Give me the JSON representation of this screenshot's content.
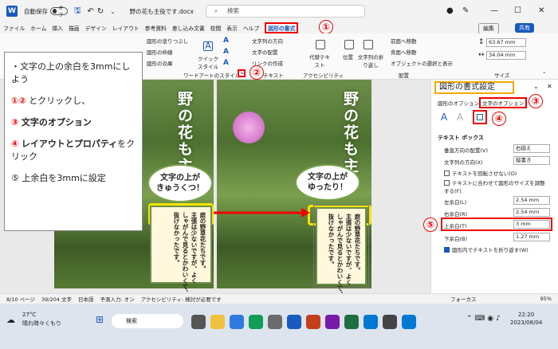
{
  "titlebar": {
    "autosave": "自動保存",
    "autosave_state": "オフ",
    "doc_title": "野の花も主役です.docx",
    "search": "検索"
  },
  "menu": [
    "ファイル",
    "ホーム",
    "挿入",
    "描画",
    "デザイン",
    "レイアウト",
    "参考資料",
    "差し込み文書",
    "校閲",
    "表示",
    "ヘルプ",
    "図形の書式"
  ],
  "menu_right": {
    "edit": "編集",
    "share": "共有"
  },
  "ribbon": {
    "insert_shapes": [
      "図形の塗りつぶし",
      "図形の枠線",
      "図形の効果"
    ],
    "quick_style": "クイック スタイル",
    "wordart_label": "ワードアートのスタイル",
    "text_group": [
      "文字列の方向",
      "文字の配置",
      "リンクの作成"
    ],
    "text_label": "テキスト",
    "alt_text": "代替テキスト",
    "access_label": "アクセシビリティ",
    "arrange": [
      "位置",
      "文字列の折り返し",
      "前面へ移動",
      "背面へ移動",
      "オブジェクトの選択と表示"
    ],
    "arrange_label": "配置",
    "size_label": "サイズ",
    "height": "63.67 mm",
    "width": "34.04 mm"
  },
  "callouts": {
    "n1": "①",
    "n2": "②",
    "n3": "③",
    "n4": "④",
    "n5": "⑤"
  },
  "instructions": {
    "line1": "・文字の上の余白を3mmにしよう",
    "line2_red": "①②",
    "line2": "とクリックし、",
    "line3_red": "③",
    "line3": "文字のオプション",
    "line4_red": "④",
    "line4": "レイアウトとプロパティ",
    "line4b": "をクリック",
    "line5": "⑤ 上余白を3mmに設定"
  },
  "doc": {
    "left_title": "野の花も主",
    "right_title": "野の花も主",
    "bubble_left": "文字の上が\nきゅうくつ！",
    "bubble_right": "文字の上が\nゆったり！",
    "note_left": "庭の野草花たちです。\n主張は少ないですが、よく\nしゃがんで見るとかわいくて、\n抜けなかったです。",
    "note_right": "庭の野草花たちです。\n主張は少ないですが、よく\nしゃがんで見るとかわいくて、\n抜けなかったです。"
  },
  "pane": {
    "title": "図形の書式設定",
    "tab_shape": "図形のオプション",
    "tab_text": "文字のオプション",
    "section": "テキスト ボックス",
    "valign_label": "垂直方向の配置(V)",
    "valign": "右揃え",
    "dir_label": "文字列の方向(X)",
    "dir": "縦書き",
    "no_rotate": "テキストを回転させない(D)",
    "autofit": "テキストに合わせて図形のサイズを調整する(F)",
    "left_label": "左余白(L)",
    "left": "2.54 mm",
    "right_label": "右余白(R)",
    "right": "2.54 mm",
    "top_label": "上余白(T)",
    "top": "3 mm",
    "bottom_label": "下余白(B)",
    "bottom": "1.27 mm",
    "wrap": "図形内でテキストを折り返す(W)"
  },
  "status": {
    "page": "8/10 ページ",
    "words": "39/204 文字",
    "lang": "日本語",
    "predict": "予測入力: オン",
    "access": "アクセシビリティ: 検討が必要です",
    "focus": "フォーカス",
    "zoom": "95%"
  },
  "taskbar": {
    "temp": "27°C",
    "weather": "晴れ時々くもり",
    "search": "検索",
    "time": "22:20",
    "date": "2023/08/04"
  }
}
